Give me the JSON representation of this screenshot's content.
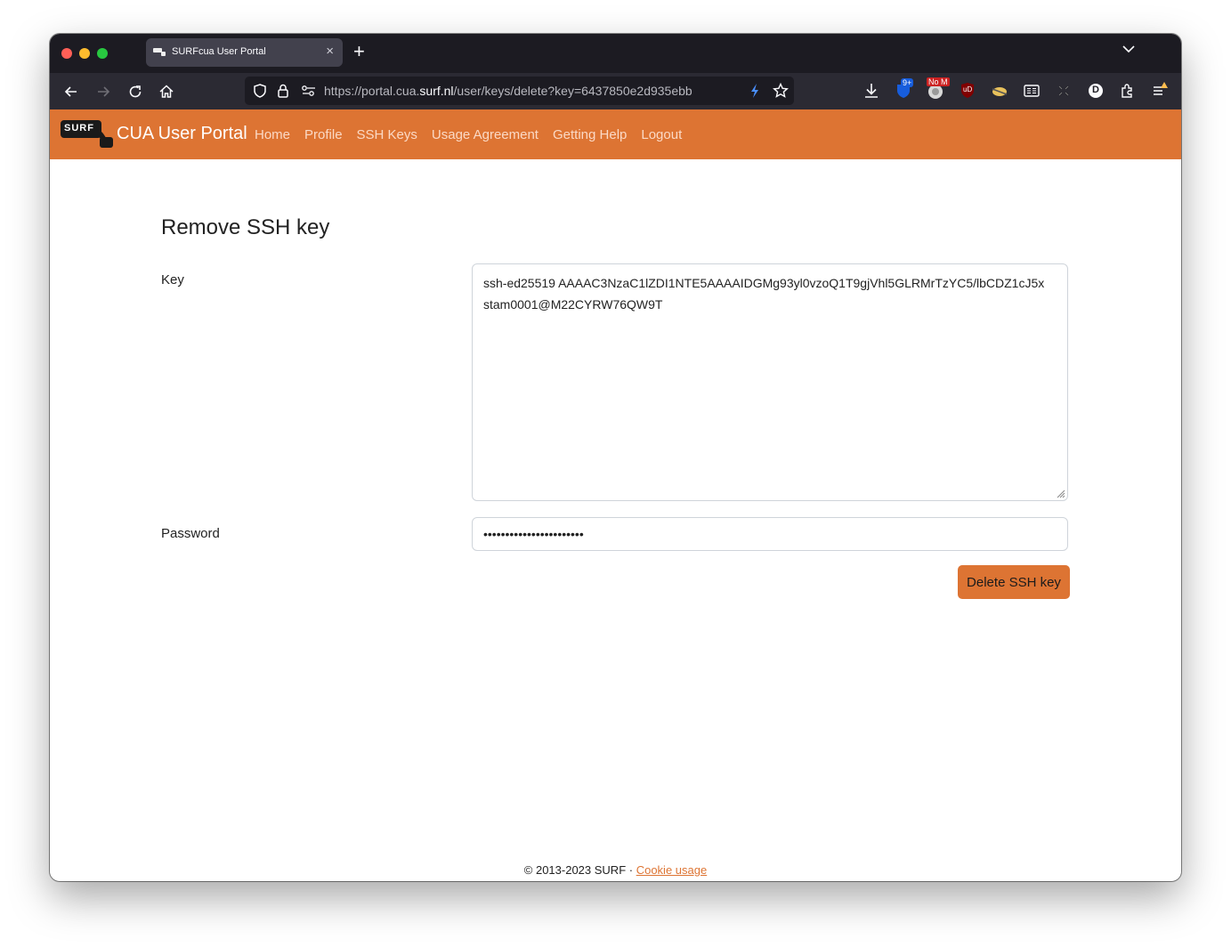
{
  "browser": {
    "tab_title": "SURFcua User Portal",
    "new_tab": "+",
    "url_prefix": "https://portal.cua.",
    "url_domain": "surf.nl",
    "url_path": "/user/keys/delete?key=6437850e2d935ebb",
    "ext_badge_1": "9+",
    "ext_badge_2": "No M",
    "ext_ublock": "uD",
    "profile_initial": "D"
  },
  "site": {
    "logo_text": "SURF",
    "brand": "CUA User Portal",
    "nav": [
      "Home",
      "Profile",
      "SSH Keys",
      "Usage Agreement",
      "Getting Help",
      "Logout"
    ],
    "accent": "#dd7433"
  },
  "form": {
    "title": "Remove SSH key",
    "key_label": "Key",
    "key_value": "ssh-ed25519 AAAAC3NzaC1lZDI1NTE5AAAAIDGMg93yl0vzoQ1T9gjVhl5GLRMrTzYC5/lbCDZ1cJ5x stam0001@M22CYRW76QW9T",
    "password_label": "Password",
    "password_value": "•••••••••••••••••••••••",
    "submit_label": "Delete SSH key"
  },
  "footer": {
    "copyright": "© 2013-2023 SURF · ",
    "cookie_link": "Cookie usage"
  }
}
